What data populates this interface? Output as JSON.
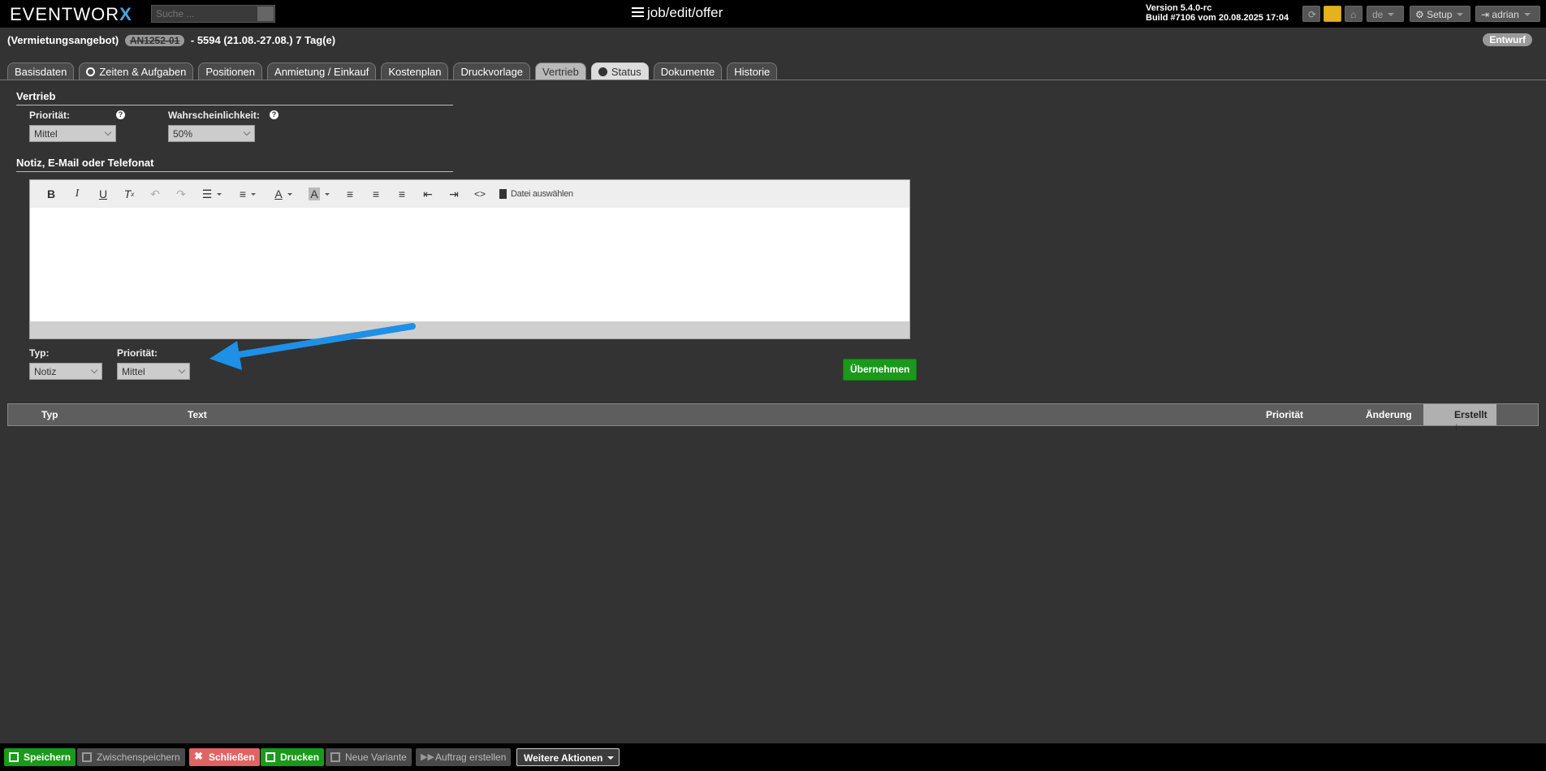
{
  "header": {
    "logo_text": "EVENTWOR",
    "logo_x": "X",
    "search_placeholder": "Suche ...",
    "route": "job/edit/offer",
    "version_line1": "Version 5.4.0-rc",
    "version_line2": "Build #7106 vom 20.08.2025 17:04",
    "lang": "de",
    "setup_label": "Setup",
    "user_label": "adrian"
  },
  "title": {
    "type": "(Vermietungsangebot)",
    "job_number": "AN1252-01",
    "rest": "- 5594 (21.08.-27.08.) 7 Tag(e)",
    "status": "Entwurf"
  },
  "tabs": [
    {
      "label": "Basisdaten"
    },
    {
      "label": "Zeiten & Aufgaben"
    },
    {
      "label": "Positionen"
    },
    {
      "label": "Anmietung / Einkauf"
    },
    {
      "label": "Kostenplan"
    },
    {
      "label": "Druckvorlage"
    },
    {
      "label": "Vertrieb"
    },
    {
      "label": "Status"
    },
    {
      "label": "Dokumente"
    },
    {
      "label": "Historie"
    }
  ],
  "vertrieb": {
    "section_title": "Vertrieb",
    "priority_label": "Priorität:",
    "priority_value": "Mittel",
    "probability_label": "Wahrscheinlichkeit:",
    "probability_value": "50%"
  },
  "note": {
    "section_title": "Notiz, E-Mail oder Telefonat",
    "file_button": "Datei auswählen",
    "type_label": "Typ:",
    "type_value": "Notiz",
    "priority_label": "Priorität:",
    "priority_value": "Mittel",
    "apply_button": "Übernehmen"
  },
  "table": {
    "columns": {
      "typ": "Typ",
      "text": "Text",
      "prioritaet": "Priorität",
      "aenderung": "Änderung",
      "erstellt": "Erstellt ↓"
    }
  },
  "footer": {
    "save": "Speichern",
    "intermediate_save": "Zwischenspeichern",
    "close": "Schließen",
    "print": "Drucken",
    "new_variant": "Neue Variante",
    "create_order": "Auftrag erstellen",
    "more_actions": "Weitere Aktionen"
  },
  "colors": {
    "accent_blue": "#4aa3e0",
    "annotation_arrow": "#1e90e6",
    "green": "#1a9a1a",
    "red": "#e06464",
    "mail_yellow": "#e4b21f"
  }
}
